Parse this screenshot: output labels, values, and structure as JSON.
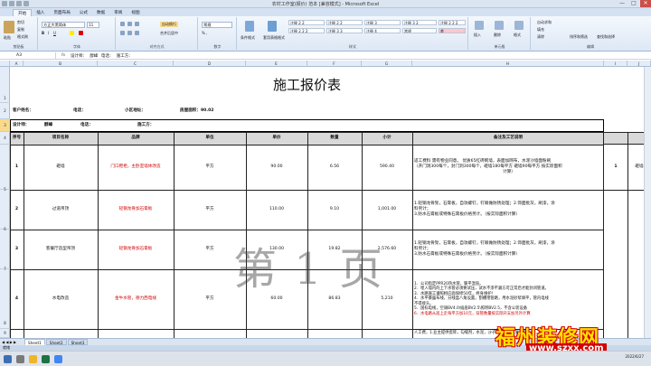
{
  "window": {
    "title": "农村工作室(报价) 范本 [兼容模式] - Microsoft Excel",
    "controls": [
      "—",
      "□",
      "✕"
    ]
  },
  "ribbon_tabs": [
    "开始",
    "插入",
    "页面布局",
    "公式",
    "数据",
    "审阅",
    "视图"
  ],
  "ribbon": {
    "clipboard": {
      "paste": "粘贴",
      "cut": "剪切",
      "copy": "复制",
      "format_painter": "格式刷",
      "label": "剪贴板"
    },
    "font": {
      "name": "方正大黑简体",
      "size": "11",
      "label": "字体"
    },
    "alignment": {
      "wrap": "自动换行",
      "merge": "合并后居中",
      "label": "对齐方式"
    },
    "number": {
      "format": "常规",
      "label": "数字"
    },
    "styles": {
      "conditional": "条件格式",
      "table": "套用表格格式",
      "cells": [
        "注释 2 2",
        "注释 2 2 2",
        "注释 2 2",
        "注释 3",
        "注释 3 2",
        "注释 2 2 2",
        "注释 3 3",
        "注释 4",
        "常规",
        "差"
      ],
      "label": "样式"
    },
    "cells": {
      "insert": "插入",
      "delete": "删除",
      "format": "格式",
      "label": "单元格"
    },
    "editing": {
      "autosum": "自动求和",
      "fill": "填充",
      "clear": "清除",
      "sort": "排序和筛选",
      "find": "查找和选择",
      "label": "编辑"
    }
  },
  "formula_bar": {
    "name_box": "A3",
    "fx": "fx",
    "content": "设计师：      醇峰       电话：              施工方："
  },
  "columns": [
    "A",
    "B",
    "C",
    "D",
    "E",
    "F",
    "G",
    "H",
    "I",
    "J"
  ],
  "rows": [
    "1",
    "2",
    "3",
    "4",
    "5",
    "6",
    "7",
    "8",
    "9",
    "10",
    "11",
    "12",
    "13"
  ],
  "sheet": {
    "title": "施工报价表",
    "info1": {
      "customer": "客户姓名：",
      "phone": "电话：",
      "address": "小区地址：",
      "area": "房屋面积：90.02"
    },
    "info2": {
      "designer": "设计师：",
      "designer_name": "醇峰",
      "phone": "电话：",
      "builder": "施工方："
    },
    "headers": [
      "序号",
      "项目名称",
      "品牌",
      "单位",
      "单价",
      "数量",
      "小计",
      "备注及工艺说明"
    ],
    "items": [
      {
        "no": "1",
        "name": "砸墙",
        "brand": "门口鞋柜，主卧室墙体改造",
        "unit": "平方",
        "price": "90.00",
        "qty": "6.56",
        "subtotal": "590.40",
        "note": [
          "适工费料  需有物业同意。  优质65红砖砌墙，表面加网布，水泥沙墙面粉刷",
          "（开门洞300每个，封门洞300每个，砸墙180每平方  砸墙90每平方  按实际面积",
          "计算）"
        ]
      },
      {
        "no": "2",
        "name": "过道吊顶",
        "brand": "轻钢龙骨加石膏板",
        "unit": "平方",
        "price": "110.00",
        "qty": "9.10",
        "subtotal": "1,001.00",
        "note": [
          "1.轻钢龙骨架，石膏板，自攻螺钉，钉眼做防锈处理；2.饰面批灰，刷漆，涂",
          "料另计；",
          "3.防水石膏板或特殊石膏板价格另计。（按实际面积计算）"
        ]
      },
      {
        "no": "3",
        "name": "客餐厅造型吊顶",
        "brand": "轻钢龙骨加石膏板",
        "unit": "平方",
        "price": "130.00",
        "qty": "19.82",
        "subtotal": "2,576.60",
        "note": [
          "1.轻钢龙骨架，石膏板，自攻螺钉，钉眼做防锈处理；2.饰面批灰，刷漆，涂",
          "料另计；",
          "3.防水石膏板或特殊石膏板价格另计。（按实际面积计算）"
        ]
      },
      {
        "no": "4",
        "name": "水电改造",
        "brand": "金牛水管，德力西电线",
        "unit": "平方",
        "price": "60.00",
        "qty": "86.83",
        "subtotal": "5,210",
        "note": [
          "1．公司指定PPR20热水管，暖平湿直。",
          "2．埋入墙内的上下水管必须要试压，试水不渗不漏方可正常后才能封闭管道。",
          "3．水路施工遵照相应面保修50年，终身维护!",
          "4．水平暴露布线，分线盒八角设置，割槽埋管路，用水泥砂浆填平，管内电线",
          "不得接头。",
          "5．国标电线，空调BV4.0\\插座BV2.5\\照明BV2.5，不含公装设备",
          "6．水电路从居上走每平方加10元，穿管数量按实际开支加另外计算"
        ]
      }
    ],
    "last_note": "人工费，1.业主提供瓷砖，勾缝剂，水泥，沙子和辅料外，施工方负责..."
  },
  "right_pane": {
    "no": "1",
    "name": "砸墙"
  },
  "watermark": "第 1 页",
  "sheet_tabs": [
    "Sheet1",
    "Sheet2",
    "Sheet3"
  ],
  "status": "就绪",
  "brand_watermark": "福州装修网",
  "brand_url": "www.szxx.com",
  "clock": {
    "time": "",
    "date": "2022/6/27"
  }
}
